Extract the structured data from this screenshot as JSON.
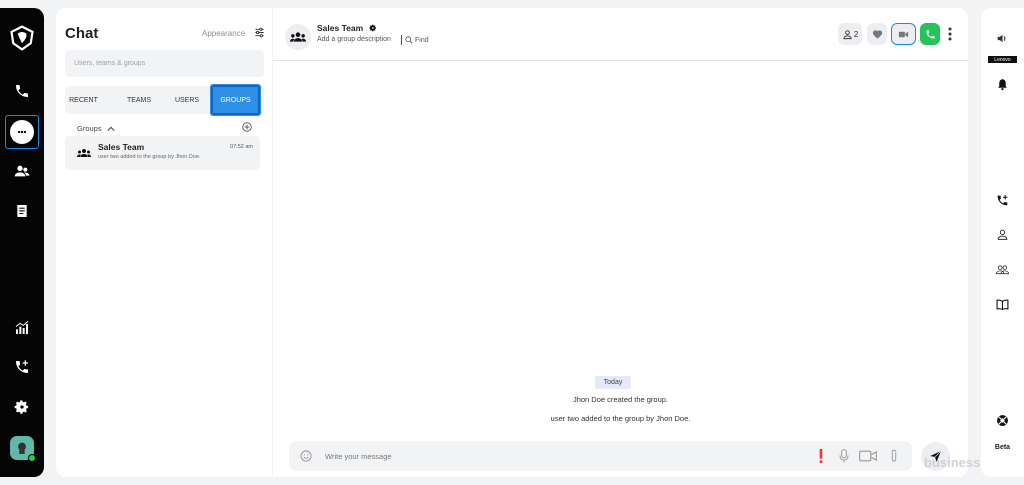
{
  "chat_panel": {
    "title": "Chat",
    "appearance_label": "Appearance",
    "search_placeholder": "Users, teams & groups",
    "tabs": [
      {
        "label": "RECENT"
      },
      {
        "label": "TEAMS"
      },
      {
        "label": "USERS"
      },
      {
        "label": "GROUPS",
        "selected": true
      }
    ],
    "groups_header": "Groups",
    "conversations": [
      {
        "name": "Sales Team",
        "time": "07:52 am",
        "preview": "user two added to the group by Jhon Doe."
      }
    ]
  },
  "main_header": {
    "title": "Sales Team",
    "description": "Add a group description",
    "find_label": "Find",
    "member_count": "2"
  },
  "messages": {
    "date_divider": "Today",
    "system": [
      "Jhon Doe created the group.",
      "user two added to the group by Jhon Doe."
    ]
  },
  "composer": {
    "placeholder": "Write your message"
  },
  "right_rail": {
    "device_label": "Lenovo",
    "beta_label": "Beta"
  },
  "watermark": "business",
  "colors": {
    "accent": "#2f8fe6",
    "call_green": "#27c259",
    "rail_bg": "#050505",
    "alert_red": "#e53935"
  },
  "icons": [
    "logo-icon",
    "phone-icon",
    "chat-icon",
    "contacts-icon",
    "notes-icon",
    "analytics-icon",
    "phone-add-icon",
    "gear-icon",
    "volume-icon",
    "bell-icon",
    "user-icon",
    "users-icon",
    "book-icon",
    "support-icon"
  ]
}
